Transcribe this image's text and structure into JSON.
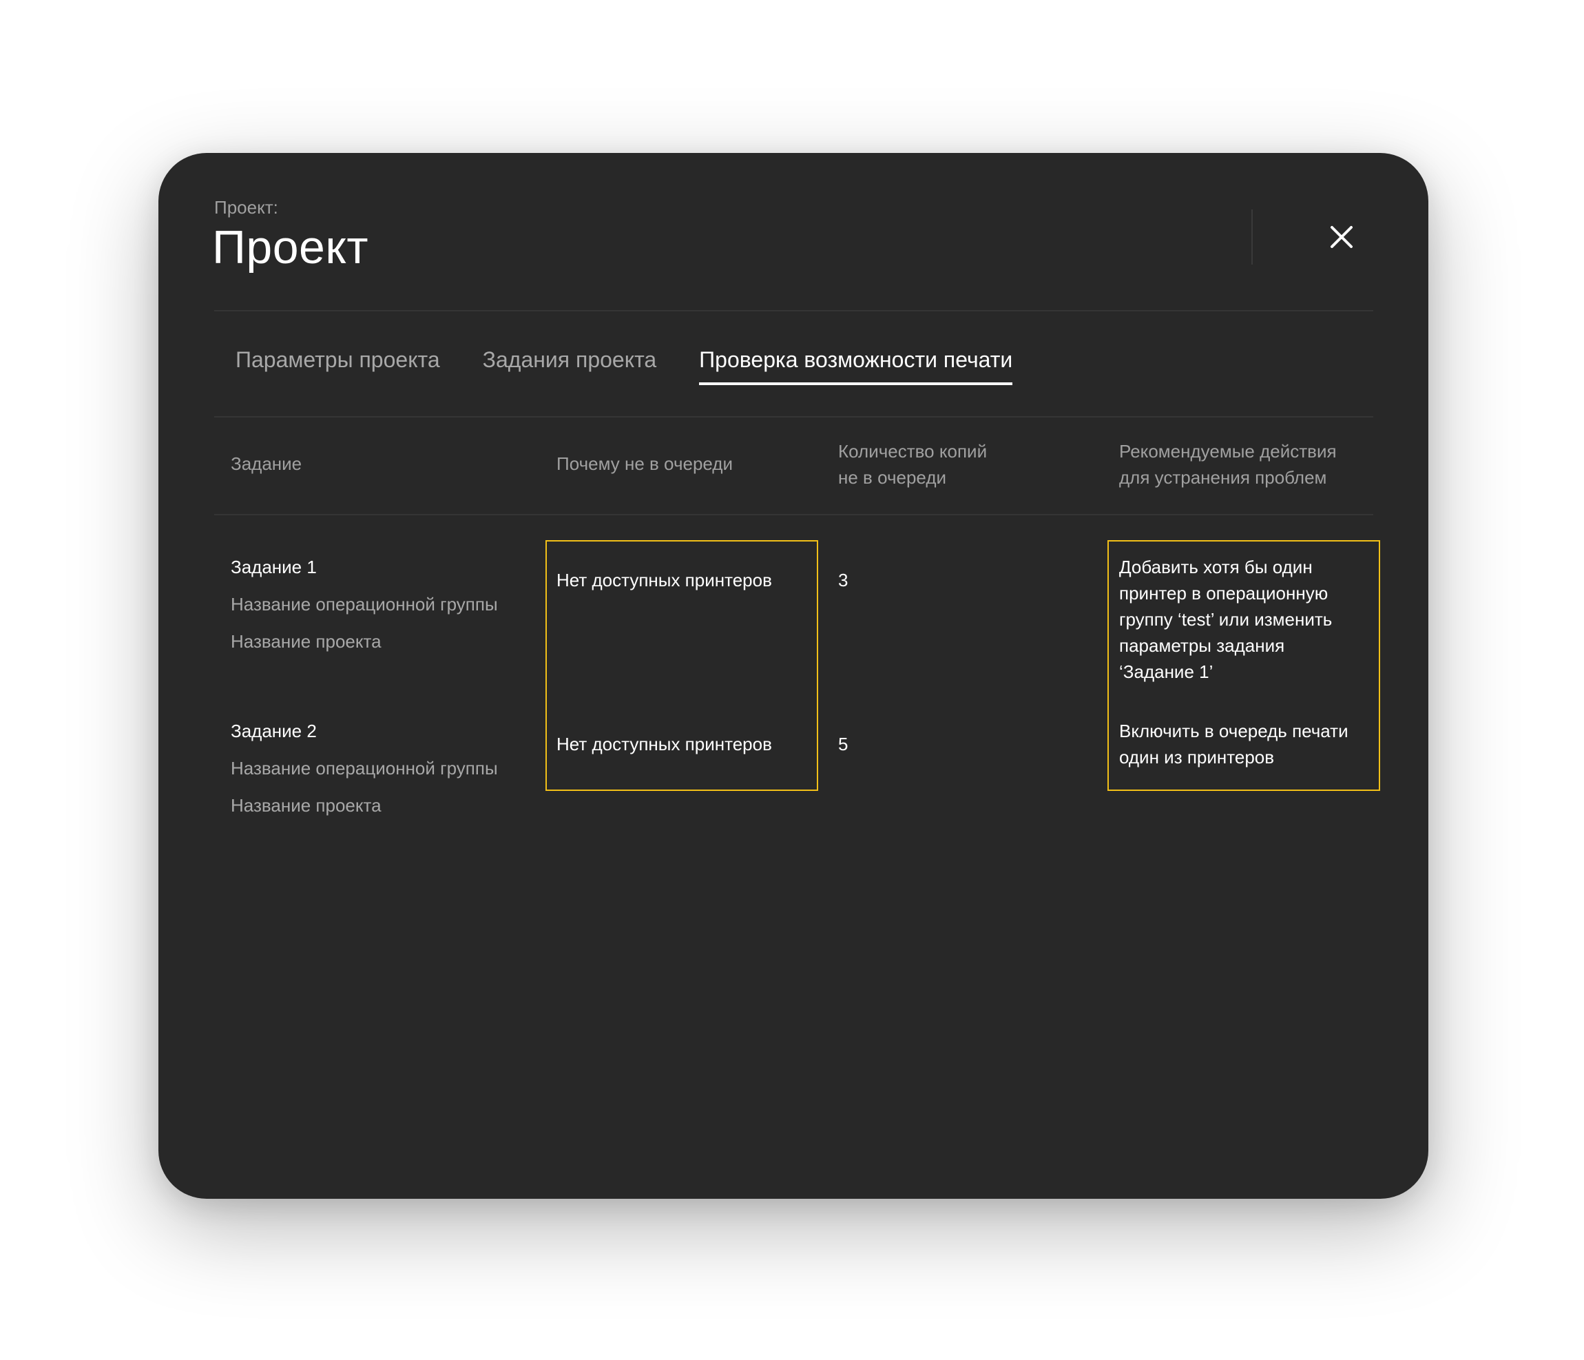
{
  "header": {
    "label": "Проект:",
    "title": "Проект"
  },
  "tabs": [
    {
      "label": "Параметры проекта",
      "active": false
    },
    {
      "label": "Задания проекта",
      "active": false
    },
    {
      "label": "Проверка возможности печати",
      "active": true
    }
  ],
  "table": {
    "headers": {
      "task": "Задание",
      "reason": "Почему не в очереди",
      "copies_line1": "Количество копий",
      "copies_line2": "не в очереди",
      "actions_line1": "Рекомендуемые действия",
      "actions_line2": "для устранения проблем"
    },
    "rows": [
      {
        "task": "Задание 1",
        "group": "Название операционной группы",
        "project": "Название проекта",
        "reason": "Нет доступных принтеров",
        "copies": "3",
        "action_lines": [
          "Добавить хотя бы один",
          "принтер в операционную",
          "группу  ‘test’ или изменить",
          "параметры задания",
          "‘Задание 1’"
        ]
      },
      {
        "task": "Задание 2",
        "group": "Название операционной группы",
        "project": "Название проекта",
        "reason": "Нет доступных принтеров",
        "copies": "5",
        "action_lines": [
          "Включить в очередь печати",
          "один из принтеров"
        ]
      }
    ]
  },
  "colors": {
    "modal_bg": "#282828",
    "highlight": "#f2c018",
    "muted_text": "#a0a0a0"
  },
  "icons": {
    "close": "close-icon"
  }
}
